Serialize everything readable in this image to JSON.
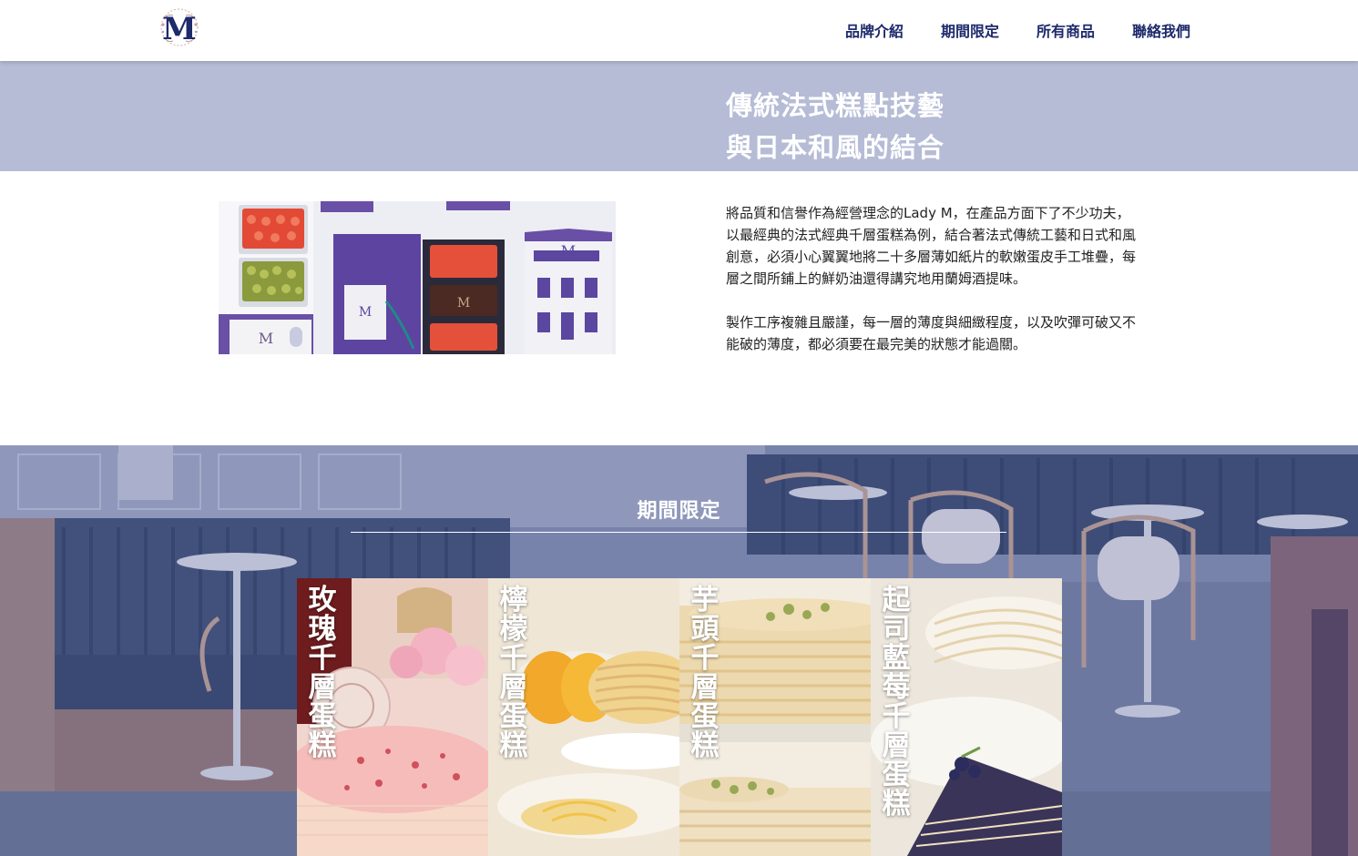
{
  "brand": {
    "logo_letter": "M",
    "logo_icon": "lady-m-monogram-icon"
  },
  "nav": {
    "items": [
      {
        "label": "品牌介紹"
      },
      {
        "label": "期間限定"
      },
      {
        "label": "所有商品"
      },
      {
        "label": "聯絡我們"
      }
    ]
  },
  "hero": {
    "line1": "傳統法式糕點技藝",
    "line2": "與日本和風的結合"
  },
  "intro": {
    "paragraph1": "將品質和信譽作為經營理念的Lady M，在產品方面下了不少功夫，以最經典的法式經典千層蛋糕為例，結合著法式傳統工藝和日式和風創意，必須小心翼翼地將二十多層薄如紙片的軟嫩蛋皮手工堆疊，每層之間所鋪上的鮮奶油還得講究地用蘭姆酒提味。",
    "paragraph2": "製作工序複雜且嚴謹，每一層的薄度與細緻程度，以及吹彈可破又不能破的薄度，都必須要在最完美的狀態才能過關。"
  },
  "seasonal": {
    "title": "期間限定",
    "items": [
      {
        "name": "玫瑰千層蛋糕"
      },
      {
        "name": "檸檬千層蛋糕"
      },
      {
        "name": "芋頭千層蛋糕"
      },
      {
        "name": "起司藍莓千層蛋糕"
      }
    ]
  },
  "colors": {
    "navy": "#1d2a6b",
    "hero_band": "#b6bcd6",
    "section_overlay": "#7e8aae"
  }
}
